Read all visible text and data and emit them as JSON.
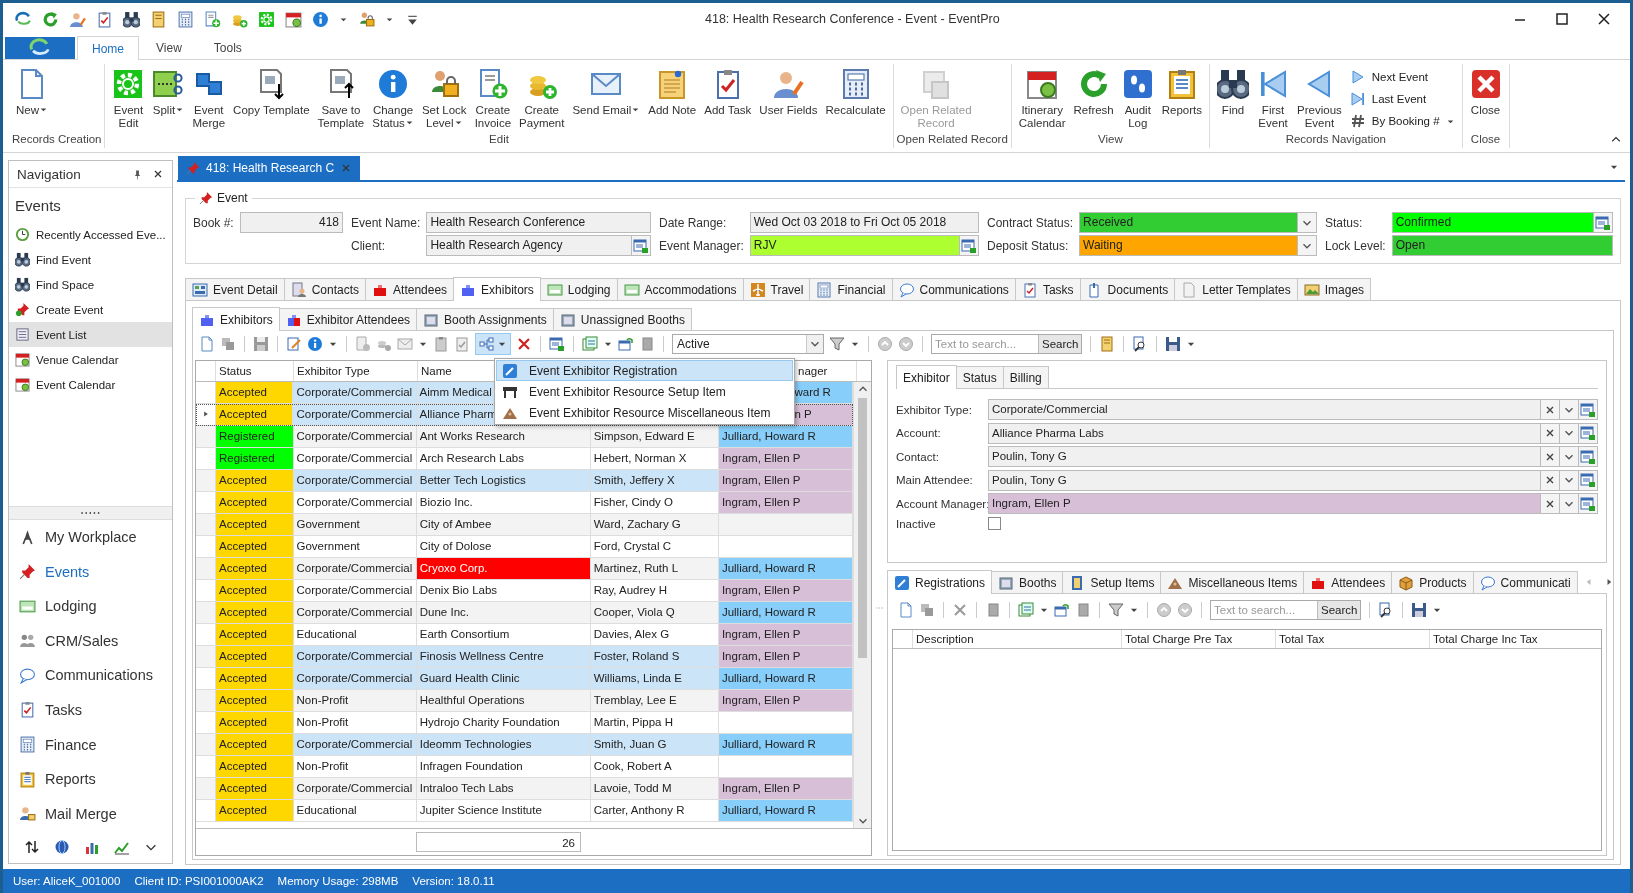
{
  "window": {
    "title": "418: Health Research Conference - Event - EventPro"
  },
  "ribbon": {
    "tabs": [
      {
        "label": "Home",
        "selected": true
      },
      {
        "label": "View",
        "selected": false
      },
      {
        "label": "Tools",
        "selected": false
      }
    ],
    "groups": [
      {
        "label": "Records Creation",
        "buttons": [
          {
            "label": "New",
            "kind": "large",
            "dropdown": true,
            "disabled": false
          }
        ]
      },
      {
        "label": "Edit",
        "buttons": [
          {
            "label": "Event\nEdit",
            "kind": "large",
            "dropdown": false,
            "disabled": false
          },
          {
            "label": "Split",
            "kind": "large",
            "dropdown": true,
            "disabled": false
          },
          {
            "label": "Event\nMerge",
            "kind": "large",
            "dropdown": false,
            "disabled": false
          },
          {
            "label": "Copy Template",
            "kind": "large",
            "dropdown": false,
            "disabled": false
          },
          {
            "label": "Save to\nTemplate",
            "kind": "large",
            "dropdown": false,
            "disabled": false
          },
          {
            "label": "Change\nStatus",
            "kind": "large",
            "dropdown": true,
            "disabled": false
          },
          {
            "label": "Set Lock\nLevel",
            "kind": "large",
            "dropdown": true,
            "disabled": false
          },
          {
            "label": "Create\nInvoice",
            "kind": "large",
            "dropdown": false,
            "disabled": false
          },
          {
            "label": "Create\nPayment",
            "kind": "large",
            "dropdown": false,
            "disabled": false
          },
          {
            "label": "Send Email",
            "kind": "large",
            "dropdown": true,
            "disabled": false
          },
          {
            "label": "Add Note",
            "kind": "large",
            "dropdown": false,
            "disabled": false
          },
          {
            "label": "Add Task",
            "kind": "large",
            "dropdown": false,
            "disabled": false
          },
          {
            "label": "User Fields",
            "kind": "large",
            "dropdown": false,
            "disabled": false
          },
          {
            "label": "Recalculate",
            "kind": "large",
            "dropdown": false,
            "disabled": false
          }
        ]
      },
      {
        "label": "Open Related Record",
        "buttons": [
          {
            "label": "Open Related\nRecord",
            "kind": "large",
            "dropdown": false,
            "disabled": true
          }
        ]
      },
      {
        "label": "View",
        "buttons": [
          {
            "label": "Itinerary\nCalendar",
            "kind": "large",
            "dropdown": false,
            "disabled": false
          },
          {
            "label": "Refresh",
            "kind": "large",
            "dropdown": false,
            "disabled": false
          },
          {
            "label": "Audit\nLog",
            "kind": "large",
            "dropdown": false,
            "disabled": false
          },
          {
            "label": "Reports",
            "kind": "large",
            "dropdown": false,
            "disabled": false
          }
        ]
      },
      {
        "label": "Records Navigation",
        "buttons": [
          {
            "label": "Find",
            "kind": "large",
            "dropdown": false,
            "disabled": false
          },
          {
            "label": "First\nEvent",
            "kind": "large",
            "dropdown": false,
            "disabled": false
          },
          {
            "label": "Previous\nEvent",
            "kind": "large",
            "dropdown": false,
            "disabled": false
          },
          {
            "label": "Next Event",
            "kind": "small",
            "dropdown": false,
            "disabled": false
          },
          {
            "label": "Last Event",
            "kind": "small",
            "dropdown": false,
            "disabled": false
          },
          {
            "label": "By Booking #",
            "kind": "small",
            "dropdown": true,
            "disabled": false
          }
        ]
      },
      {
        "label": "Close",
        "buttons": [
          {
            "label": "Close",
            "kind": "large",
            "dropdown": false,
            "disabled": false
          }
        ]
      }
    ]
  },
  "navigation": {
    "title": "Navigation",
    "heading": "Events",
    "items": [
      {
        "label": "Recently Accessed Eve...",
        "selected": false
      },
      {
        "label": "Find Event",
        "selected": false
      },
      {
        "label": "Find Space",
        "selected": false
      },
      {
        "label": "Create Event",
        "selected": false
      },
      {
        "label": "Event List",
        "selected": true
      },
      {
        "label": "Venue Calendar",
        "selected": false
      },
      {
        "label": "Event Calendar",
        "selected": false
      }
    ],
    "modules": [
      {
        "label": "My Workplace",
        "selected": false
      },
      {
        "label": "Events",
        "selected": true
      },
      {
        "label": "Lodging",
        "selected": false
      },
      {
        "label": "CRM/Sales",
        "selected": false
      },
      {
        "label": "Communications",
        "selected": false
      },
      {
        "label": "Tasks",
        "selected": false
      },
      {
        "label": "Finance",
        "selected": false
      },
      {
        "label": "Reports",
        "selected": false
      },
      {
        "label": "Mail Merge",
        "selected": false
      }
    ]
  },
  "document_tab": {
    "title": "418: Health Research C"
  },
  "event": {
    "title": "Event",
    "columns": [
      [
        {
          "label": "Book #:",
          "value": "418",
          "kind": "number"
        }
      ],
      [
        {
          "label": "Event Name:",
          "value": "Health Research Conference",
          "kind": "text"
        },
        {
          "label": "Client:",
          "value": "Health Research Agency",
          "kind": "lookup"
        }
      ],
      [
        {
          "label": "Date Range:",
          "value": "Wed Oct 03 2018 to Fri Oct 05 2018",
          "kind": "text"
        },
        {
          "label": "Event Manager:",
          "value": "RJV",
          "kind": "lookup",
          "color": "#adff2f"
        }
      ],
      [
        {
          "label": "Contract Status:",
          "value": "Received",
          "kind": "combo",
          "color": "#32cd32"
        },
        {
          "label": "Deposit Status:",
          "value": "Waiting",
          "kind": "combo",
          "color": "#ffa500"
        }
      ],
      [
        {
          "label": "Status:",
          "value": "Confirmed",
          "kind": "lookup",
          "color": "#00ff00"
        },
        {
          "label": "Lock Level:",
          "value": "Open",
          "kind": "text",
          "color": "#32cd32"
        }
      ]
    ]
  },
  "tabs": [
    {
      "label": "Event Detail",
      "selected": false
    },
    {
      "label": "Contacts",
      "selected": false
    },
    {
      "label": "Attendees",
      "selected": false
    },
    {
      "label": "Exhibitors",
      "selected": true
    },
    {
      "label": "Lodging",
      "selected": false
    },
    {
      "label": "Accommodations",
      "selected": false
    },
    {
      "label": "Travel",
      "selected": false
    },
    {
      "label": "Financial",
      "selected": false
    },
    {
      "label": "Communications",
      "selected": false
    },
    {
      "label": "Tasks",
      "selected": false
    },
    {
      "label": "Documents",
      "selected": false
    },
    {
      "label": "Letter Templates",
      "selected": false
    },
    {
      "label": "Images",
      "selected": false
    }
  ],
  "exhibitors": {
    "subtabs": [
      {
        "label": "Exhibitors",
        "selected": true
      },
      {
        "label": "Exhibitor Attendees",
        "selected": false
      },
      {
        "label": "Booth Assignments",
        "selected": false
      },
      {
        "label": "Unassigned Booths",
        "selected": false
      }
    ],
    "filter": {
      "value": "Active"
    },
    "search": {
      "placeholder": "Text to search...",
      "button": "Search"
    },
    "menu": {
      "open": true,
      "items": [
        {
          "label": "Event Exhibitor Registration",
          "selected": true
        },
        {
          "label": "Event Exhibitor Resource Setup Item",
          "selected": false
        },
        {
          "label": "Event Exhibitor Resource Miscellaneous Item",
          "selected": false
        }
      ]
    },
    "grid": {
      "columns": [
        {
          "label": "Status"
        },
        {
          "label": "Exhibitor Type"
        },
        {
          "label": "Name"
        },
        {},
        {
          "label": "nager",
          "cut_left": true
        }
      ],
      "rows": [
        {
          "selected": false,
          "highlighted": true,
          "cells": [
            {
              "text": "Accepted",
              "color": "#ffd700"
            },
            {
              "text": "Corporate/Commercial"
            },
            {
              "text": "Aimm Medical"
            },
            {},
            {
              "text": "ward R",
              "color": "#87cefa",
              "cut_left": true
            }
          ]
        },
        {
          "selected": true,
          "highlighted": true,
          "cells": [
            {
              "text": "Accepted",
              "color": "#ffd700"
            },
            {
              "text": "Corporate/Commercial"
            },
            {
              "text": "Alliance Pharm"
            },
            {},
            {
              "text": "n P",
              "color": "#d8bfd8",
              "cut_left": true
            }
          ]
        },
        {
          "selected": false,
          "highlighted": false,
          "cells": [
            {
              "text": "Registered",
              "color": "#00ff00"
            },
            {
              "text": "Corporate/Commercial"
            },
            {
              "text": "Ant Works Research"
            },
            {
              "text": "Simpson, Edward E"
            },
            {
              "text": "Julliard, Howard R",
              "color": "#87cefa"
            }
          ]
        },
        {
          "selected": false,
          "highlighted": false,
          "cells": [
            {
              "text": "Registered",
              "color": "#00ff00"
            },
            {
              "text": "Corporate/Commercial"
            },
            {
              "text": "Arch Research Labs"
            },
            {
              "text": "Hebert, Norman X"
            },
            {
              "text": "Ingram, Ellen P",
              "color": "#d8bfd8"
            }
          ]
        },
        {
          "selected": false,
          "highlighted": true,
          "cells": [
            {
              "text": "Accepted",
              "color": "#ffd700"
            },
            {
              "text": "Corporate/Commercial"
            },
            {
              "text": "Better Tech Logistics"
            },
            {
              "text": "Smith, Jeffery X"
            },
            {
              "text": "Ingram, Ellen P",
              "color": "#d8bfd8"
            }
          ]
        },
        {
          "selected": false,
          "highlighted": false,
          "cells": [
            {
              "text": "Accepted",
              "color": "#ffd700"
            },
            {
              "text": "Corporate/Commercial"
            },
            {
              "text": "Biozio Inc."
            },
            {
              "text": "Fisher, Cindy O"
            },
            {
              "text": "Ingram, Ellen P",
              "color": "#d8bfd8"
            }
          ]
        },
        {
          "selected": false,
          "highlighted": false,
          "cells": [
            {
              "text": "Accepted",
              "color": "#ffd700"
            },
            {
              "text": "Government"
            },
            {
              "text": "City of Ambee"
            },
            {
              "text": "Ward, Zachary G"
            },
            {}
          ]
        },
        {
          "selected": false,
          "highlighted": false,
          "cells": [
            {
              "text": "Accepted",
              "color": "#ffd700"
            },
            {
              "text": "Government"
            },
            {
              "text": "City of Dolose"
            },
            {
              "text": "Ford, Crystal C"
            },
            {}
          ]
        },
        {
          "selected": false,
          "highlighted": false,
          "cells": [
            {
              "text": "Accepted",
              "color": "#ffd700"
            },
            {
              "text": "Corporate/Commercial"
            },
            {
              "text": "Cryoxo Corp.",
              "color": "#ff0000"
            },
            {
              "text": "Martinez, Ruth L"
            },
            {
              "text": "Julliard, Howard R",
              "color": "#87cefa"
            }
          ]
        },
        {
          "selected": false,
          "highlighted": false,
          "cells": [
            {
              "text": "Accepted",
              "color": "#ffd700"
            },
            {
              "text": "Corporate/Commercial"
            },
            {
              "text": "Denix Bio Labs"
            },
            {
              "text": "Ray, Audrey H"
            },
            {
              "text": "Ingram, Ellen P",
              "color": "#d8bfd8"
            }
          ]
        },
        {
          "selected": false,
          "highlighted": false,
          "cells": [
            {
              "text": "Accepted",
              "color": "#ffd700"
            },
            {
              "text": "Corporate/Commercial"
            },
            {
              "text": "Dune Inc."
            },
            {
              "text": "Cooper, Viola Q"
            },
            {
              "text": "Julliard, Howard R",
              "color": "#87cefa"
            }
          ]
        },
        {
          "selected": false,
          "highlighted": false,
          "cells": [
            {
              "text": "Accepted",
              "color": "#ffd700"
            },
            {
              "text": "Educational"
            },
            {
              "text": "Earth Consortium"
            },
            {
              "text": "Davies, Alex G"
            },
            {
              "text": "Ingram, Ellen P",
              "color": "#d8bfd8"
            }
          ]
        },
        {
          "selected": false,
          "highlighted": true,
          "cells": [
            {
              "text": "Accepted",
              "color": "#ffd700"
            },
            {
              "text": "Corporate/Commercial"
            },
            {
              "text": "Finosis Wellness Centre"
            },
            {
              "text": "Foster, Roland S"
            },
            {
              "text": "Ingram, Ellen P",
              "color": "#d8bfd8"
            }
          ]
        },
        {
          "selected": false,
          "highlighted": true,
          "cells": [
            {
              "text": "Accepted",
              "color": "#ffd700"
            },
            {
              "text": "Corporate/Commercial"
            },
            {
              "text": "Guard Health Clinic"
            },
            {
              "text": "Williams, Linda E"
            },
            {
              "text": "Julliard, Howard R",
              "color": "#87cefa"
            }
          ]
        },
        {
          "selected": false,
          "highlighted": false,
          "cells": [
            {
              "text": "Accepted",
              "color": "#ffd700"
            },
            {
              "text": "Non-Profit"
            },
            {
              "text": "Healthful Operations"
            },
            {
              "text": "Tremblay, Lee E"
            },
            {
              "text": "Ingram, Ellen P",
              "color": "#d8bfd8"
            }
          ]
        },
        {
          "selected": false,
          "highlighted": false,
          "cells": [
            {
              "text": "Accepted",
              "color": "#ffd700"
            },
            {
              "text": "Non-Profit"
            },
            {
              "text": "Hydrojo Charity Foundation"
            },
            {
              "text": "Martin, Pippa H"
            },
            {}
          ]
        },
        {
          "selected": false,
          "highlighted": true,
          "cells": [
            {
              "text": "Accepted",
              "color": "#ffd700"
            },
            {
              "text": "Corporate/Commercial"
            },
            {
              "text": "Ideomm Technologies"
            },
            {
              "text": "Smith, Juan G"
            },
            {
              "text": "Julliard, Howard R",
              "color": "#87cefa"
            }
          ]
        },
        {
          "selected": false,
          "highlighted": false,
          "cells": [
            {
              "text": "Accepted",
              "color": "#ffd700"
            },
            {
              "text": "Non-Profit"
            },
            {
              "text": "Infragen Foundation"
            },
            {
              "text": "Cook, Robert A"
            },
            {}
          ]
        },
        {
          "selected": false,
          "highlighted": false,
          "cells": [
            {
              "text": "Accepted",
              "color": "#ffd700"
            },
            {
              "text": "Corporate/Commercial"
            },
            {
              "text": "Intraloo Tech Labs"
            },
            {
              "text": "Lavoie, Todd M"
            },
            {
              "text": "Ingram, Ellen P",
              "color": "#d8bfd8"
            }
          ]
        },
        {
          "selected": false,
          "highlighted": false,
          "cells": [
            {
              "text": "Accepted",
              "color": "#ffd700"
            },
            {
              "text": "Educational"
            },
            {
              "text": "Jupiter Science Institute"
            },
            {
              "text": "Carter, Anthony R"
            },
            {
              "text": "Julliard, Howard R",
              "color": "#87cefa"
            }
          ]
        }
      ],
      "footer_count": "26"
    }
  },
  "detail": {
    "tabs": [
      {
        "label": "Exhibitor",
        "selected": true
      },
      {
        "label": "Status",
        "selected": false
      },
      {
        "label": "Billing",
        "selected": false
      }
    ],
    "fields": [
      {
        "label": "Exhibitor Type:",
        "value": "Corporate/Commercial"
      },
      {
        "label": "Account:",
        "value": "Alliance Pharma Labs"
      },
      {
        "label": "Contact:",
        "value": "Poulin, Tony G"
      },
      {
        "label": "Main Attendee:",
        "value": "Poulin, Tony G"
      },
      {
        "label": "Account Manager:",
        "value": "Ingram, Ellen P",
        "color": "#d8bfd8"
      }
    ],
    "checkbox": {
      "label": "Inactive",
      "checked": false
    }
  },
  "registrations": {
    "tabs": [
      {
        "label": "Registrations",
        "selected": true
      },
      {
        "label": "Booths",
        "selected": false
      },
      {
        "label": "Setup Items",
        "selected": false
      },
      {
        "label": "Miscellaneous Items",
        "selected": false
      },
      {
        "label": "Attendees",
        "selected": false
      },
      {
        "label": "Products",
        "selected": false
      },
      {
        "label": "Communicati",
        "selected": false
      }
    ],
    "search": {
      "placeholder": "Text to search...",
      "button": "Search"
    },
    "columns": [
      "Description",
      "Total Charge Pre Tax",
      "Total Tax",
      "Total Charge Inc Tax"
    ]
  },
  "status_bar": [
    "User: AliceK_001000",
    "Client ID: PSI001000AK2",
    "Memory Usage: 298MB",
    "Version: 18.0.11"
  ]
}
